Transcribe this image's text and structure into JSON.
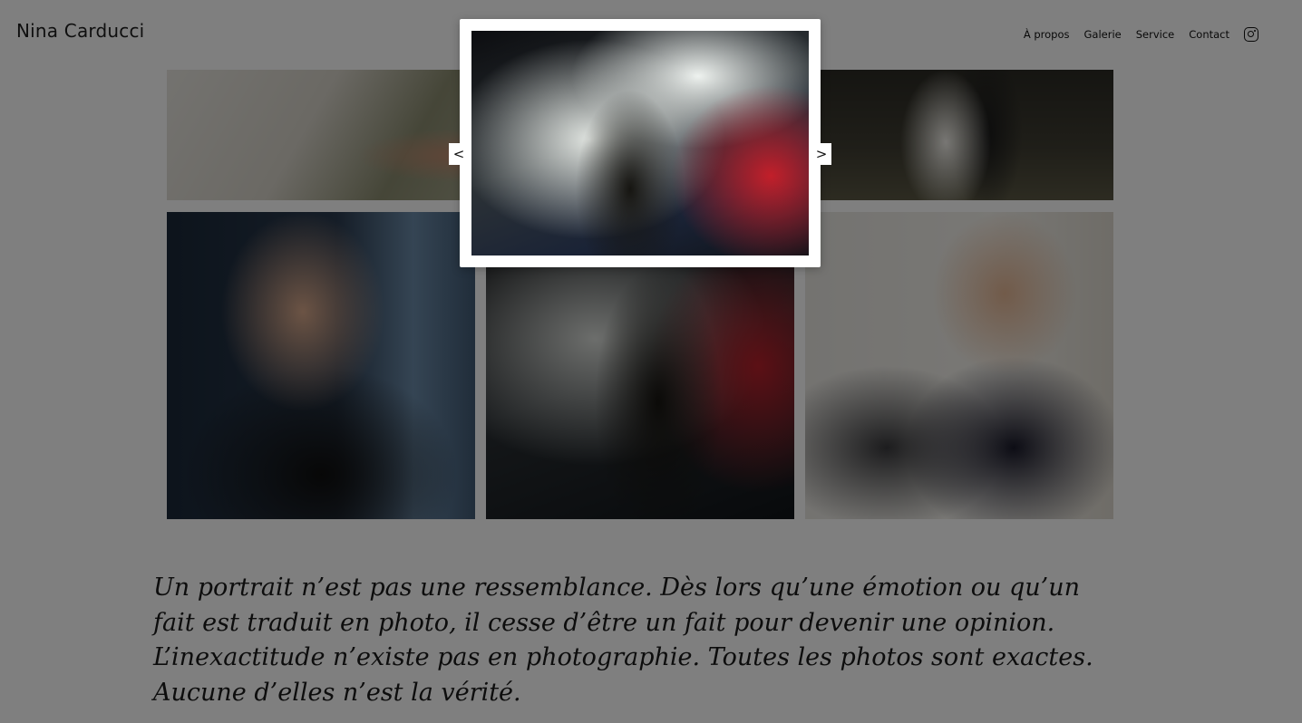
{
  "header": {
    "brand": "Nina Carducci",
    "nav": [
      {
        "label": "À propos"
      },
      {
        "label": "Galerie"
      },
      {
        "label": "Service"
      },
      {
        "label": "Contact"
      }
    ],
    "social_icon": "instagram-icon"
  },
  "quote": {
    "text": "Un portrait n’est pas une ressemblance. Dès lors qu’une émotion ou qu’un fait est traduit en photo, il cesse d’être un fait pour devenir une opinion. L’inexactitude n’existe pas en photographie. Toutes les photos sont exactes. Aucune d’elles n’est la vérité."
  },
  "lightbox": {
    "prev_label": "<",
    "next_label": ">"
  }
}
